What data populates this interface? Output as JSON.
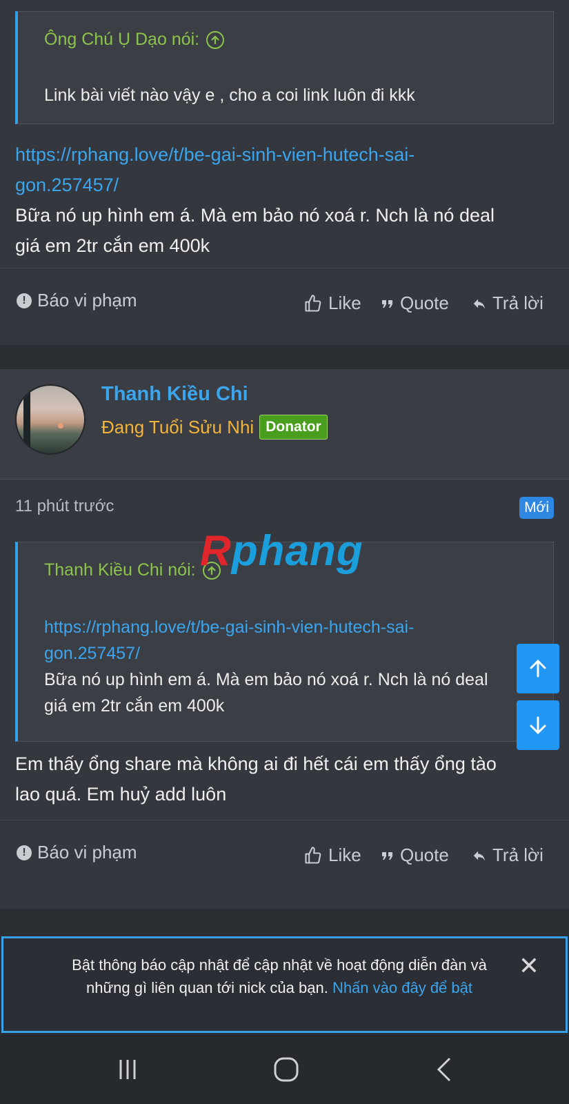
{
  "post1": {
    "quote_author": "Ông Chú Ụ Dạo nói:",
    "quote_text": "Link bài viết nào vậy e , cho a coi link luôn đi kkk",
    "link_line1": "https://rphang.love/t/be-gai-sinh-vien-hutech-sai-",
    "link_line2": "gon.257457/",
    "body_line1": "Bữa nó up hình em á. Mà em bảo nó xoá r. Nch là nó deal",
    "body_line2": "giá em 2tr cắn em 400k"
  },
  "actions": {
    "report": "Báo vi phạm",
    "like": "Like",
    "quote": "Quote",
    "reply": "Trả lời"
  },
  "post2": {
    "username": "Thanh Kiều Chi",
    "user_title": "Đang Tuổi Sửu Nhi",
    "badge": "Donator",
    "time": "11 phút trước",
    "new_badge": "Mới",
    "quote_author": "Thanh Kiều Chi nói:",
    "quote_link_line1": "https://rphang.love/t/be-gai-sinh-vien-hutech-sai-",
    "quote_link_line2": "gon.257457/",
    "quote_body_line1": "Bữa nó up hình em á. Mà em bảo nó xoá r. Nch là nó deal",
    "quote_body_line2": "giá em 2tr cắn em 400k",
    "body_line1": "Em thấy ổng share mà không ai đi hết cái em thấy ổng tào",
    "body_line2": "lao quá. Em huỷ add luôn"
  },
  "watermark": {
    "r": "R",
    "rest": "phang"
  },
  "notice": {
    "text_line1": "Bật thông báo cập nhật để cập nhật về hoạt động diễn đàn và",
    "text_line2": "những gì liên quan tới nick của bạn.",
    "link": "Nhấn vào đây để bật",
    "close": "✕"
  },
  "colors": {
    "accent": "#3ba5ee",
    "quote_author": "#8cc44b",
    "user_title": "#f2b43a",
    "donator": "#4a9e1d",
    "new_badge": "#2e87e0"
  }
}
